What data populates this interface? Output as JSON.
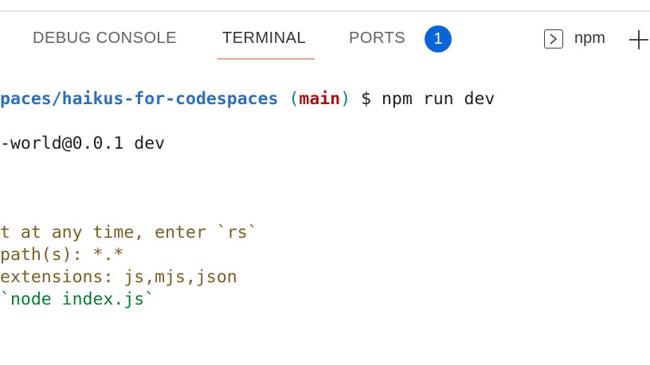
{
  "tabs": [
    {
      "label": "DEBUG CONSOLE",
      "active": false
    },
    {
      "label": "TERMINAL",
      "active": true
    },
    {
      "label": "PORTS",
      "active": false
    }
  ],
  "ports_badge": "1",
  "terminal_instance": "npm",
  "icons": {
    "terminal": "terminal-icon",
    "add": "plus-icon"
  },
  "terminal": {
    "prompt_path": "paces/haikus-for-codespaces",
    "prompt_paren_open": "(",
    "prompt_branch": "main",
    "prompt_paren_close": ")",
    "prompt_command": " $ npm run dev",
    "line2": "-world@0.0.1 dev",
    "line3": "t at any time, enter `rs`",
    "line4": "path(s): *.*",
    "line5": "extensions: js,mjs,json",
    "line6": "`node index.js`"
  },
  "colors": {
    "accent_underline": "#e8a796",
    "badge": "#0b64d8",
    "path": "#2f6fb6",
    "branch": "#a31515",
    "warning_text": "#795e26",
    "success_text": "#0b7a32"
  }
}
